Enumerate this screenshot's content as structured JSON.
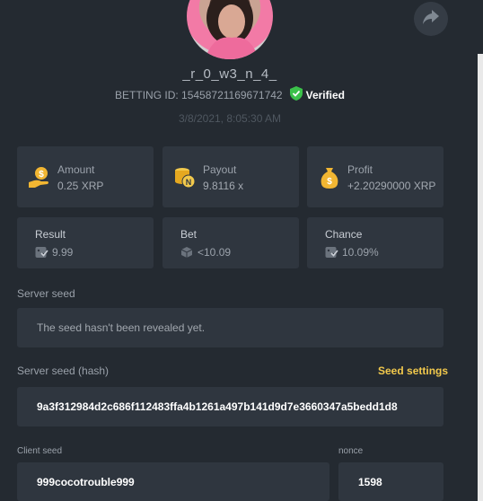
{
  "profile": {
    "username": "_r_0_w3_n_4_",
    "betting_id": "BETTING ID: 15458721169671742",
    "verified_label": "Verified",
    "timestamp": "3/8/2021, 8:05:30 AM"
  },
  "stats": [
    {
      "label": "Amount",
      "value": "0.25 XRP",
      "icon": "money-hand-icon"
    },
    {
      "label": "Payout",
      "value": "9.8116 x",
      "icon": "coin-stack-icon"
    },
    {
      "label": "Profit",
      "value": "+2.20290000 XRP",
      "icon": "money-bag-icon"
    }
  ],
  "mini_stats": [
    {
      "label": "Result",
      "value": "9.99"
    },
    {
      "label": "Bet",
      "value": "<10.09"
    },
    {
      "label": "Chance",
      "value": "10.09%"
    }
  ],
  "server_seed": {
    "label": "Server seed",
    "value": "The seed hasn't been revealed yet."
  },
  "server_seed_hash": {
    "label": "Server seed (hash)",
    "settings_label": "Seed settings",
    "value": "9a3f312984d2c686f112483ffa4b1261a497b141d9d7e3660347a5bedd1d8"
  },
  "client_seed": {
    "label": "Client seed",
    "value": "999cocotrouble999"
  },
  "nonce": {
    "label": "nonce",
    "value": "1598"
  },
  "colors": {
    "background": "#242a31",
    "card": "#2f363f",
    "accent_yellow": "#f2c94c",
    "verified_green": "#3bc14a"
  }
}
